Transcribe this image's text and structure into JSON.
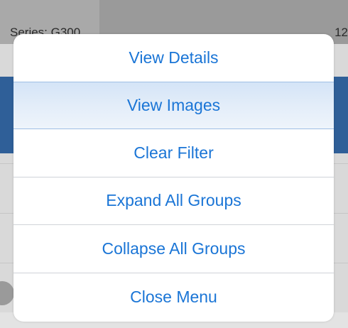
{
  "background": {
    "series_label": "Series: G300",
    "count_label": "12"
  },
  "menu": {
    "items": [
      {
        "label": "View Details"
      },
      {
        "label": "View Images"
      },
      {
        "label": "Clear Filter"
      },
      {
        "label": "Expand All Groups"
      },
      {
        "label": "Collapse All Groups"
      },
      {
        "label": "Close Menu"
      }
    ],
    "highlighted_index": 1
  },
  "colors": {
    "menu_text": "#1a75d6",
    "highlight": "#d9e7f8",
    "underlay_blue": "#2f5f98"
  }
}
